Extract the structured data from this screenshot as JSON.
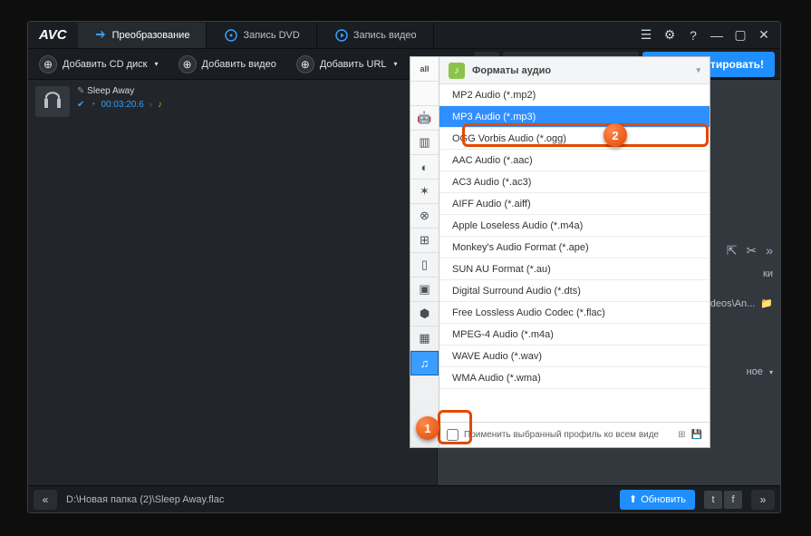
{
  "logo": "AVC",
  "tabs": [
    {
      "label": "Преобразование"
    },
    {
      "label": "Запись DVD"
    },
    {
      "label": "Запись видео"
    }
  ],
  "toolbar": {
    "add_cd": "Добавить CD диск",
    "add_video": "Добавить видео",
    "add_url": "Добавить URL"
  },
  "profile_selected": "MP3 Audio (*.mp3)",
  "convert": "Конвертировать!",
  "file": {
    "title": "Sleep Away",
    "duration": "00:03:20.6"
  },
  "panel_header": "Форматы аудио",
  "formats": [
    "MP2 Audio (*.mp2)",
    "MP3 Audio (*.mp3)",
    "OGG Vorbis Audio (*.ogg)",
    "AAC Audio (*.aac)",
    "AC3 Audio (*.ac3)",
    "AIFF Audio (*.aiff)",
    "Apple Loseless Audio (*.m4a)",
    "Monkey's Audio Format (*.ape)",
    "SUN AU Format (*.au)",
    "Digital Surround Audio (*.dts)",
    "Free Lossless Audio Codec (*.flac)",
    "MPEG-4 Audio (*.m4a)",
    "WAVE Audio (*.wav)",
    "WMA Audio (*.wma)"
  ],
  "apply_profile": "Применить выбранный профиль ко всем виде",
  "side": {
    "tabs_label": "ки",
    "output": "K\\Videos\\An...",
    "line": "ное"
  },
  "status": {
    "path": "D:\\Новая папка (2)\\Sleep Away.flac",
    "update": "Обновить"
  },
  "annotations": {
    "a1": "1",
    "a2": "2"
  }
}
